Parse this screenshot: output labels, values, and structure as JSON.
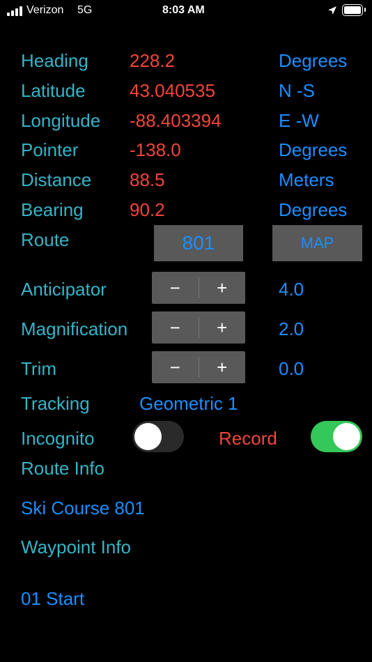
{
  "status_bar": {
    "carrier": "Verizon",
    "network": "5G",
    "time": "8:03 AM"
  },
  "readouts": [
    {
      "label": "Heading",
      "value": "228.2",
      "unit": "Degrees"
    },
    {
      "label": "Latitude",
      "value": "43.040535",
      "unit": "N -S"
    },
    {
      "label": "Longitude",
      "value": "-88.403394",
      "unit": "E -W"
    },
    {
      "label": "Pointer",
      "value": "-138.0",
      "unit": "Degrees"
    },
    {
      "label": "Distance",
      "value": "88.5",
      "unit": "Meters"
    },
    {
      "label": "Bearing",
      "value": "90.2",
      "unit": "Degrees"
    }
  ],
  "route": {
    "label": "Route",
    "number": "801",
    "map_button": "MAP"
  },
  "steppers": [
    {
      "label": "Anticipator",
      "minus": "−",
      "plus": "+",
      "value": "4.0"
    },
    {
      "label": "Magnification",
      "minus": "−",
      "plus": "+",
      "value": "2.0"
    },
    {
      "label": "Trim",
      "minus": "−",
      "plus": "+",
      "value": "0.0"
    }
  ],
  "tracking": {
    "label": "Tracking",
    "value": "Geometric 1"
  },
  "incognito": {
    "label": "Incognito",
    "on": false
  },
  "record": {
    "label": "Record",
    "on": true
  },
  "route_info": {
    "label": "Route Info",
    "value": "Ski Course 801"
  },
  "waypoint_info": {
    "label": "Waypoint Info",
    "value": "01 Start"
  },
  "colors": {
    "label_teal": "#35b4c7",
    "value_red": "#f2453c",
    "accent_blue": "#1b8fff",
    "button_gray": "#595959",
    "toggle_green": "#34c759",
    "toggle_off": "#2a2a2a"
  }
}
